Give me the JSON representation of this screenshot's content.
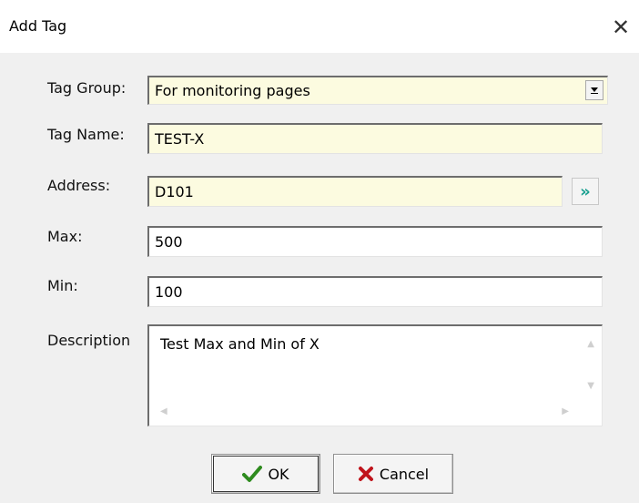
{
  "window": {
    "title": "Add Tag",
    "close_glyph": "✕"
  },
  "form": {
    "tag_group": {
      "label": "Tag Group:",
      "value": "For monitoring pages"
    },
    "tag_name": {
      "label": "Tag Name:",
      "value": "TEST-X"
    },
    "address": {
      "label": "Address:",
      "value": "D101",
      "browse_glyph": "»"
    },
    "max": {
      "label": "Max:",
      "value": "500"
    },
    "min": {
      "label": "Min:",
      "value": "100"
    },
    "description": {
      "label": "Description",
      "value": "Test Max and Min of X"
    }
  },
  "buttons": {
    "ok": {
      "label": "OK",
      "icon": "check-icon",
      "icon_color": "#2e8b1e"
    },
    "cancel": {
      "label": "Cancel",
      "icon": "x-icon",
      "icon_color": "#c0141c"
    }
  },
  "colors": {
    "required_field_bg": "#fcfbe0",
    "browse_accent": "#1aa090"
  }
}
